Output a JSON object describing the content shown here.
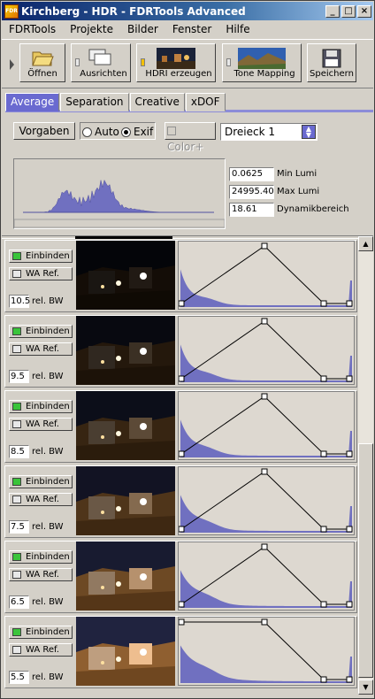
{
  "window": {
    "title": "Kirchberg - HDR - FDRTools Advanced",
    "icon_text": "FDR",
    "min": "_",
    "max": "□",
    "close": "×"
  },
  "menu": [
    "FDRTools",
    "Projekte",
    "Bilder",
    "Fenster",
    "Hilfe"
  ],
  "toolbar": {
    "open": "Öffnen",
    "align": "Ausrichten",
    "hdri": "HDRI erzeugen",
    "tonemap": "Tone Mapping",
    "save": "Speichern"
  },
  "tabs": [
    "Average",
    "Separation",
    "Creative",
    "xDOF"
  ],
  "controls": {
    "vorgaben": "Vorgaben",
    "auto": "Auto",
    "exif": "Exif",
    "color": "Color+",
    "preset": "Dreieck 1",
    "selected": "Exif"
  },
  "stats": {
    "min_val": "0.0625",
    "min_lbl": "Min Lumi",
    "max_val": "24995.40",
    "max_lbl": "Max Lumi",
    "dyn_val": "18.61",
    "dyn_lbl": "Dynamikbereich"
  },
  "rows": [
    {
      "einbinden": "Einbinden",
      "waref": "WA Ref.",
      "bw": "10.5",
      "bwlbl": "rel. BW",
      "brightness": 0.1
    },
    {
      "einbinden": "Einbinden",
      "waref": "WA Ref.",
      "bw": "9.5",
      "bwlbl": "rel. BW",
      "brightness": 0.18
    },
    {
      "einbinden": "Einbinden",
      "waref": "WA Ref.",
      "bw": "8.5",
      "bwlbl": "rel. BW",
      "brightness": 0.28
    },
    {
      "einbinden": "Einbinden",
      "waref": "WA Ref.",
      "bw": "7.5",
      "bwlbl": "rel. BW",
      "brightness": 0.4
    },
    {
      "einbinden": "Einbinden",
      "waref": "WA Ref.",
      "bw": "6.5",
      "bwlbl": "rel. BW",
      "brightness": 0.55
    },
    {
      "einbinden": "Einbinden",
      "waref": "WA Ref.",
      "bw": "5.5",
      "bwlbl": "rel. BW",
      "brightness": 0.72
    }
  ],
  "colors": {
    "accent": "#6a6ad0",
    "histogram": "#7070c0",
    "title_start": "#0a246a",
    "title_end": "#a6caf0",
    "led_on": "#3ac43a"
  }
}
